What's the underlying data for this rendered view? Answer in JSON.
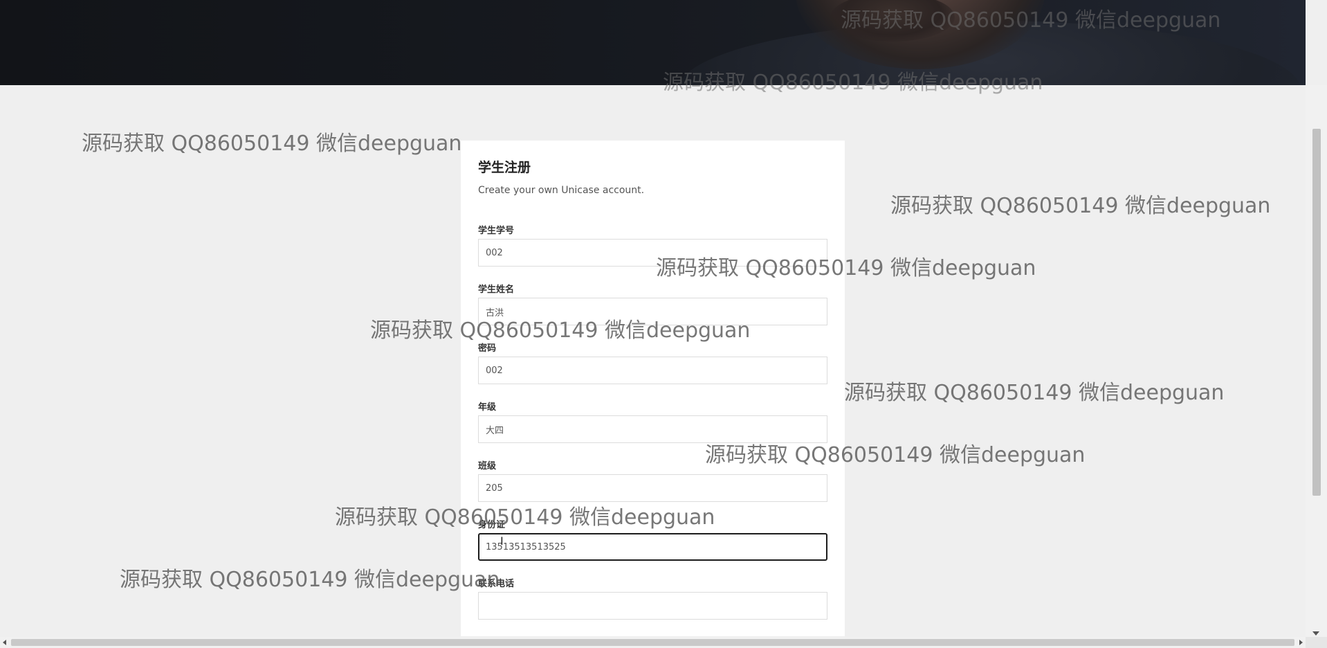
{
  "form": {
    "title": "学生注册",
    "subtitle": "Create your own Unicase account.",
    "fields": [
      {
        "label": "学生学号",
        "value": "002"
      },
      {
        "label": "学生姓名",
        "value": "古洪"
      },
      {
        "label": "密码",
        "value": "002"
      },
      {
        "label": "年级",
        "value": "大四"
      },
      {
        "label": "班级",
        "value": "205"
      },
      {
        "label": "身份证",
        "value": "13513513513525"
      },
      {
        "label": "联系电话",
        "value": ""
      }
    ]
  },
  "watermark": {
    "text": "源码获取 QQ86050149 微信deepguan"
  },
  "icons": {
    "text_cursor": "text-cursor-icon"
  }
}
